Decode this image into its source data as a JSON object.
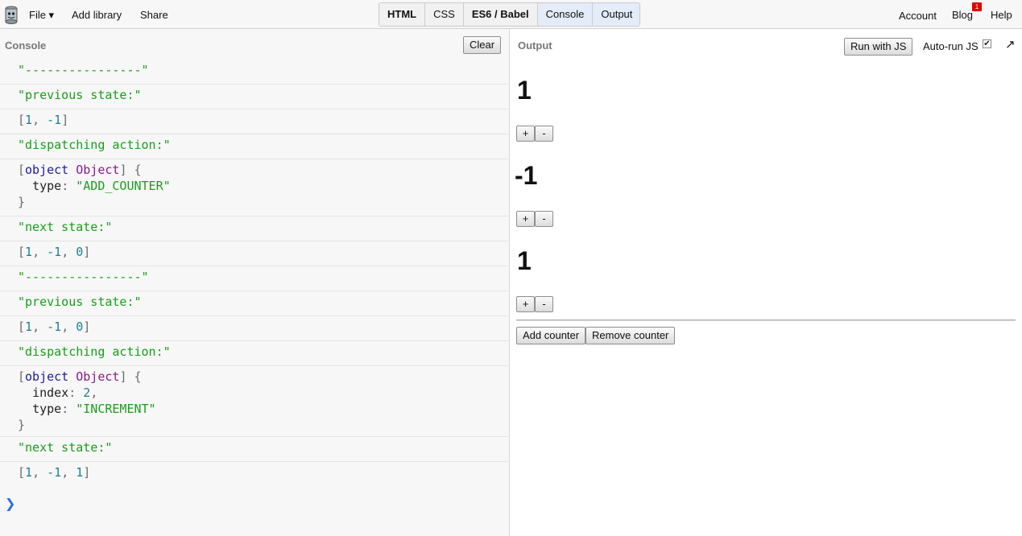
{
  "topbar": {
    "file": "File ▾",
    "add_library": "Add library",
    "share": "Share",
    "tabs": [
      "HTML",
      "CSS",
      "ES6 / Babel",
      "Console",
      "Output"
    ],
    "account": "Account",
    "blog": "Blog",
    "blog_badge": "1",
    "help": "Help"
  },
  "console": {
    "title": "Console",
    "clear": "Clear",
    "prompt": "❯",
    "entries": [
      {
        "kind": "string",
        "text": "\"----------------\""
      },
      {
        "kind": "string",
        "text": "\"previous state:\""
      },
      {
        "kind": "array",
        "values": [
          "1",
          "-1"
        ]
      },
      {
        "kind": "string",
        "text": "\"dispatching action:\""
      },
      {
        "kind": "object",
        "fields": [
          {
            "key": "type",
            "value": "\"ADD_COUNTER\""
          }
        ]
      },
      {
        "kind": "string",
        "text": "\"next state:\""
      },
      {
        "kind": "array",
        "values": [
          "1",
          "-1",
          "0"
        ]
      },
      {
        "kind": "string",
        "text": "\"----------------\""
      },
      {
        "kind": "string",
        "text": "\"previous state:\""
      },
      {
        "kind": "array",
        "values": [
          "1",
          "-1",
          "0"
        ]
      },
      {
        "kind": "string",
        "text": "\"dispatching action:\""
      },
      {
        "kind": "object",
        "fields": [
          {
            "key": "index",
            "value": "2"
          },
          {
            "key": "type",
            "value": "\"INCREMENT\""
          }
        ]
      },
      {
        "kind": "string",
        "text": "\"next state:\""
      },
      {
        "kind": "array",
        "values": [
          "1",
          "-1",
          "1"
        ]
      }
    ]
  },
  "output": {
    "title": "Output",
    "run_button": "Run with JS",
    "autorun_label": "Auto-run JS",
    "autorun_checked": "✔",
    "popout_icon": "↗",
    "counters": [
      "1",
      "-1",
      "1"
    ],
    "plus": "+",
    "minus": "-",
    "add_counter": "Add counter",
    "remove_counter": "Remove counter"
  }
}
